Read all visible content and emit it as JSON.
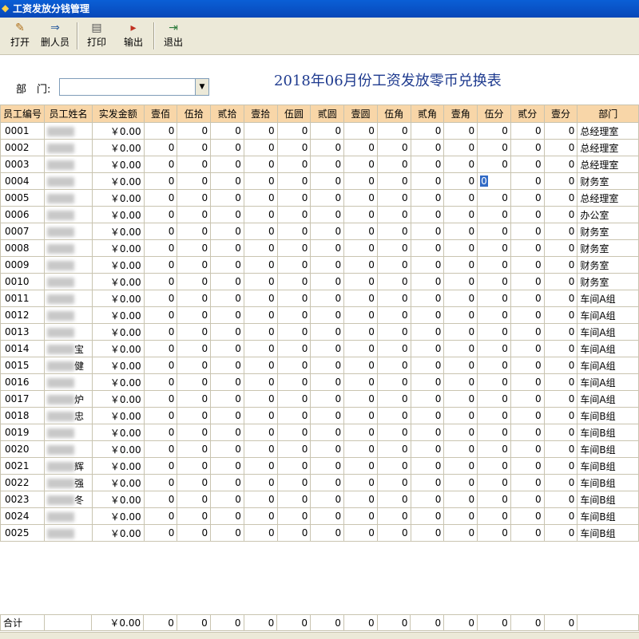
{
  "window": {
    "title": "工资发放分钱管理"
  },
  "toolbar": [
    {
      "key": "open",
      "label": "打开",
      "icon": "open-icon"
    },
    {
      "key": "delete",
      "label": "删人员",
      "icon": "delete-person-icon"
    },
    {
      "key": "print",
      "label": "打印",
      "icon": "print-icon"
    },
    {
      "key": "export",
      "label": "输出",
      "icon": "export-icon"
    },
    {
      "key": "exit",
      "label": "退出",
      "icon": "exit-icon"
    }
  ],
  "filter": {
    "dept_label": "部　门:",
    "dept_value": ""
  },
  "report_title": "2018年06月份工资发放零币兑换表",
  "columns": [
    "员工编号",
    "员工姓名",
    "实发金额",
    "壹佰",
    "伍拾",
    "贰拾",
    "壹拾",
    "伍圆",
    "贰圆",
    "壹圆",
    "伍角",
    "贰角",
    "壹角",
    "伍分",
    "贰分",
    "壹分",
    "部门"
  ],
  "rows": [
    {
      "id": "0001",
      "name": "",
      "amount": "￥0.00",
      "dept": "总经理室"
    },
    {
      "id": "0002",
      "name": "",
      "amount": "￥0.00",
      "dept": "总经理室"
    },
    {
      "id": "0003",
      "name": "",
      "amount": "￥0.00",
      "dept": "总经理室"
    },
    {
      "id": "0004",
      "name": "",
      "amount": "￥0.00",
      "dept": "财务室"
    },
    {
      "id": "0005",
      "name": "",
      "amount": "￥0.00",
      "dept": "总经理室"
    },
    {
      "id": "0006",
      "name": "",
      "amount": "￥0.00",
      "dept": "办公室"
    },
    {
      "id": "0007",
      "name": "",
      "amount": "￥0.00",
      "dept": "财务室"
    },
    {
      "id": "0008",
      "name": "",
      "amount": "￥0.00",
      "dept": "财务室"
    },
    {
      "id": "0009",
      "name": "",
      "amount": "￥0.00",
      "dept": "财务室"
    },
    {
      "id": "0010",
      "name": "",
      "amount": "￥0.00",
      "dept": "财务室"
    },
    {
      "id": "0011",
      "name": "",
      "amount": "￥0.00",
      "dept": "车间A组"
    },
    {
      "id": "0012",
      "name": "",
      "amount": "￥0.00",
      "dept": "车间A组"
    },
    {
      "id": "0013",
      "name": "",
      "amount": "￥0.00",
      "dept": "车间A组"
    },
    {
      "id": "0014",
      "name": "宝",
      "amount": "￥0.00",
      "dept": "车间A组"
    },
    {
      "id": "0015",
      "name": "健",
      "amount": "￥0.00",
      "dept": "车间A组"
    },
    {
      "id": "0016",
      "name": "",
      "amount": "￥0.00",
      "dept": "车间A组"
    },
    {
      "id": "0017",
      "name": "炉",
      "amount": "￥0.00",
      "dept": "车间A组"
    },
    {
      "id": "0018",
      "name": "忠",
      "amount": "￥0.00",
      "dept": "车间B组"
    },
    {
      "id": "0019",
      "name": "",
      "amount": "￥0.00",
      "dept": "车间B组"
    },
    {
      "id": "0020",
      "name": "",
      "amount": "￥0.00",
      "dept": "车间B组"
    },
    {
      "id": "0021",
      "name": "辉",
      "amount": "￥0.00",
      "dept": "车间B组"
    },
    {
      "id": "0022",
      "name": "强",
      "amount": "￥0.00",
      "dept": "车间B组"
    },
    {
      "id": "0023",
      "name": "冬",
      "amount": "￥0.00",
      "dept": "车间B组"
    },
    {
      "id": "0024",
      "name": "",
      "amount": "￥0.00",
      "dept": "车间B组"
    },
    {
      "id": "0025",
      "name": "",
      "amount": "￥0.00",
      "dept": "车间B组"
    }
  ],
  "denomination_values": "0",
  "selected_cell": {
    "row": 4,
    "column": "伍分"
  },
  "totals": {
    "label": "合计",
    "amount": "￥0.00"
  }
}
